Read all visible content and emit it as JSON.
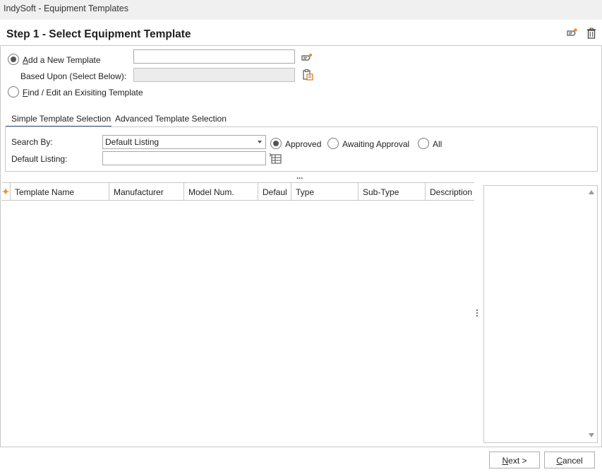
{
  "window": {
    "title": "IndySoft - Equipment Templates"
  },
  "header": {
    "step_title": "Step 1 - Select Equipment Template"
  },
  "options": {
    "add_new_prefix": "",
    "add_new_hotkey": "A",
    "add_new_rest": "dd a New Template",
    "add_new_value": "",
    "based_upon_label": "Based Upon (Select Below):",
    "based_upon_value": "",
    "find_edit_hotkey": "F",
    "find_edit_rest": "ind / Edit an Exisiting Template",
    "selected": "add_new"
  },
  "tabs": [
    {
      "label": "Simple Template Selection",
      "active": true
    },
    {
      "label": "Advanced Template Selection",
      "active": false
    }
  ],
  "filters": {
    "search_by_label": "Search By:",
    "search_by_value": "Default Listing",
    "default_listing_label": "Default Listing:",
    "default_listing_value": "",
    "status_options": [
      "Approved",
      "Awaiting Approval",
      "All"
    ],
    "status_selected": "Approved"
  },
  "splitter_dots": "...",
  "grid": {
    "columns": [
      "Template Name",
      "Manufacturer",
      "Model Num.",
      "Defaul",
      "Type",
      "Sub-Type",
      "Description"
    ],
    "rows": []
  },
  "buttons": {
    "next_hotkey": "N",
    "next_rest": "ext >",
    "cancel_hotkey": "C",
    "cancel_rest": "ancel"
  },
  "colors": {
    "tab_accent": "#3f5e8c",
    "row_marker": "#f08a24"
  }
}
